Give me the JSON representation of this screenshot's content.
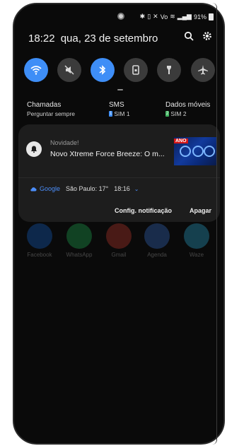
{
  "status_bar": {
    "battery_percent": "91%"
  },
  "header": {
    "time": "18:22",
    "date": "qua, 23 de setembro"
  },
  "quick_settings": [
    {
      "name": "wifi",
      "state": "on"
    },
    {
      "name": "mute",
      "state": "off"
    },
    {
      "name": "bluetooth",
      "state": "on"
    },
    {
      "name": "screen-rotation",
      "state": "off"
    },
    {
      "name": "flashlight",
      "state": "off"
    },
    {
      "name": "airplane-mode",
      "state": "off"
    }
  ],
  "sim_settings": {
    "calls": {
      "label": "Chamadas",
      "value": "Perguntar sempre"
    },
    "sms": {
      "label": "SMS",
      "badge": "1",
      "value": "SIM 1"
    },
    "mobile_data": {
      "label": "Dados móveis",
      "badge": "2",
      "value": "SIM 2"
    }
  },
  "notification": {
    "title": "Novidade!",
    "body": "Novo Xtreme Force Breeze: O m...",
    "thumbnail_label": "ANO",
    "google_row": {
      "app": "Google",
      "info": "São Paulo: 17°",
      "time": "18:16"
    },
    "actions": {
      "settings": "Config. notificação",
      "clear": "Apagar"
    }
  },
  "background_apps": [
    {
      "name": "Facebook",
      "color": "#1877f2"
    },
    {
      "name": "WhatsApp",
      "color": "#25d366"
    },
    {
      "name": "Gmail",
      "color": "#ea4335"
    },
    {
      "name": "Agenda",
      "color": "#4285f4"
    },
    {
      "name": "Waze",
      "color": "#33ccff"
    }
  ],
  "colors": {
    "accent": "#3e8ef7",
    "panel": "#0a0a0a",
    "card": "#1d1d1d"
  }
}
